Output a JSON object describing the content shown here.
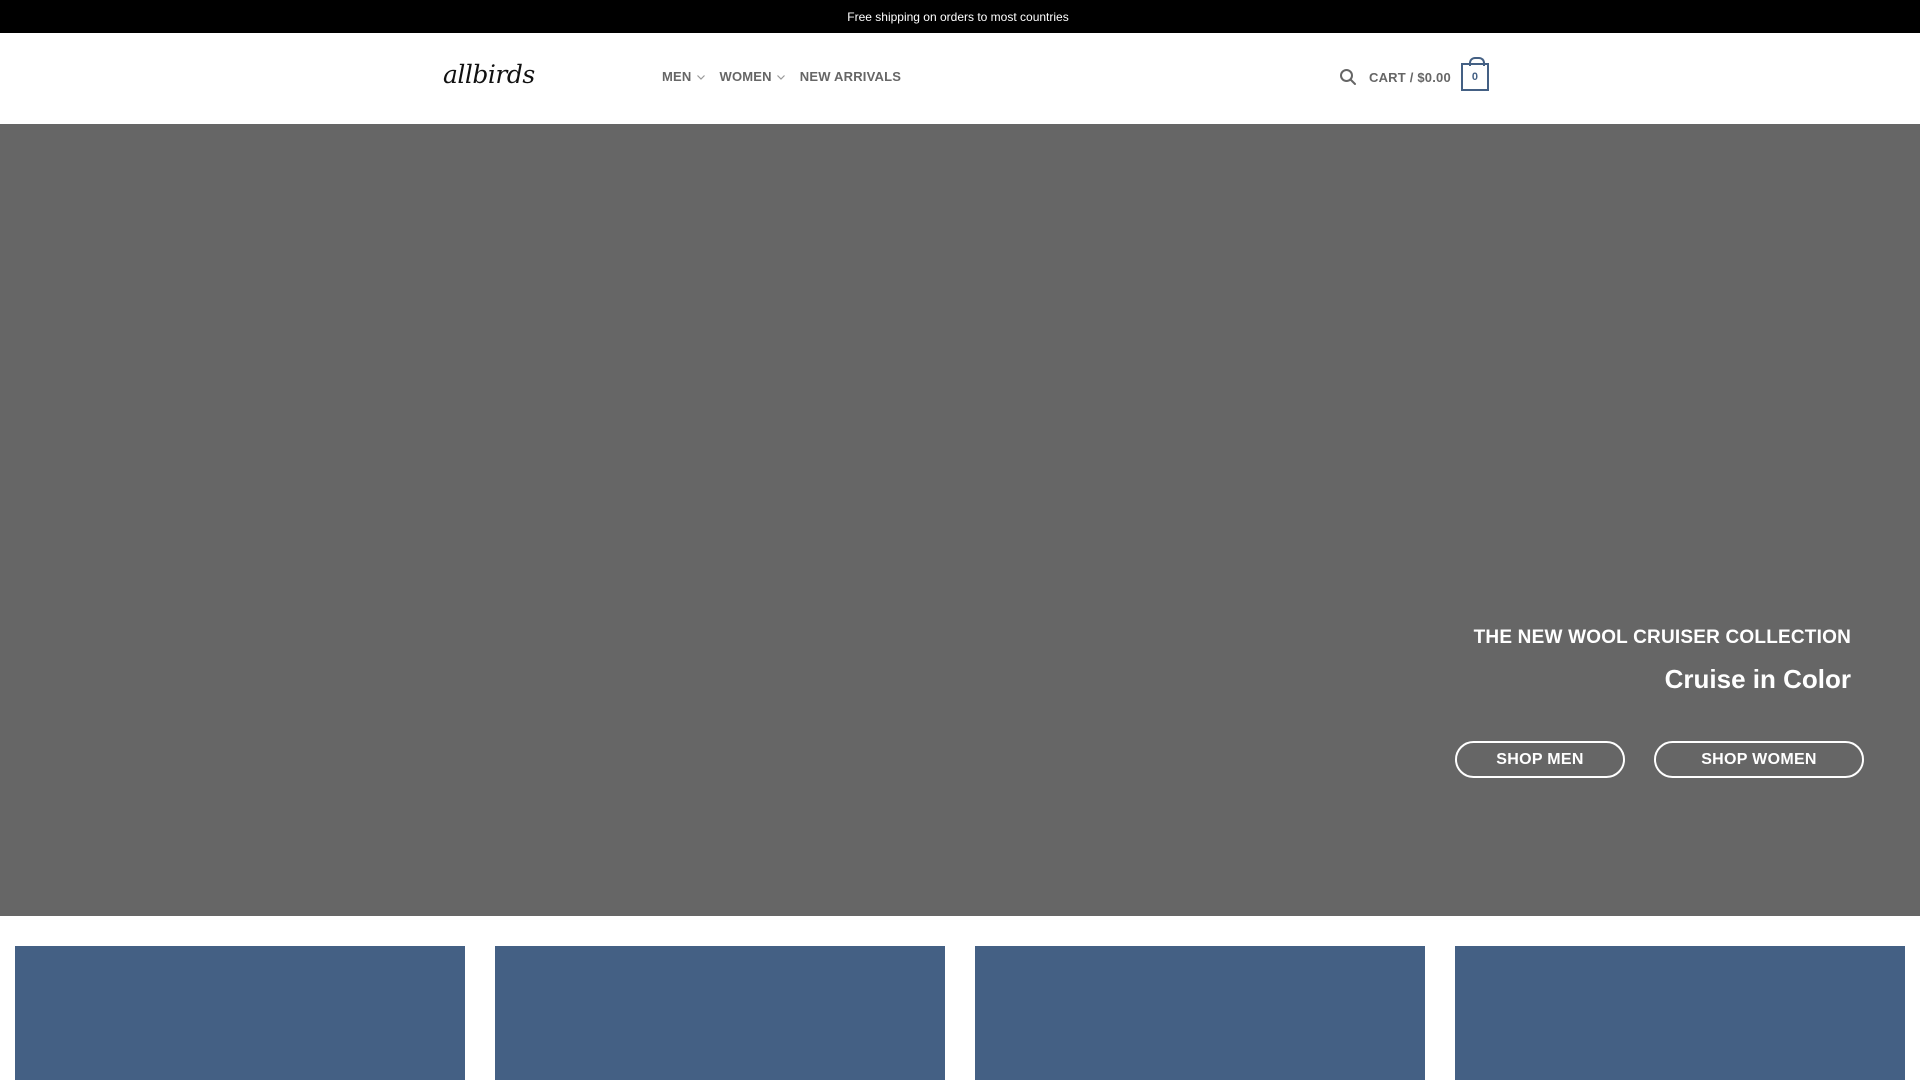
{
  "announcement": {
    "text": "Free shipping on orders to most countries"
  },
  "header": {
    "logo_text": "allbirds",
    "nav": [
      {
        "label": "MEN",
        "has_dropdown": true
      },
      {
        "label": "WOMEN",
        "has_dropdown": true
      },
      {
        "label": "NEW ARRIVALS",
        "has_dropdown": false
      }
    ],
    "search_icon": "search-icon",
    "cart_label": "CART / $0.00",
    "cart_count": "0"
  },
  "hero": {
    "eyebrow": "THE NEW WOOL CRUISER COLLECTION",
    "title": "Cruise in Color",
    "buttons": [
      {
        "label": "SHOP MEN"
      },
      {
        "label": "SHOP WOMEN"
      }
    ]
  },
  "colors": {
    "topbar": "#000000",
    "hero_bg": "#666666",
    "accent": "#446084",
    "nav_text": "#666666"
  }
}
